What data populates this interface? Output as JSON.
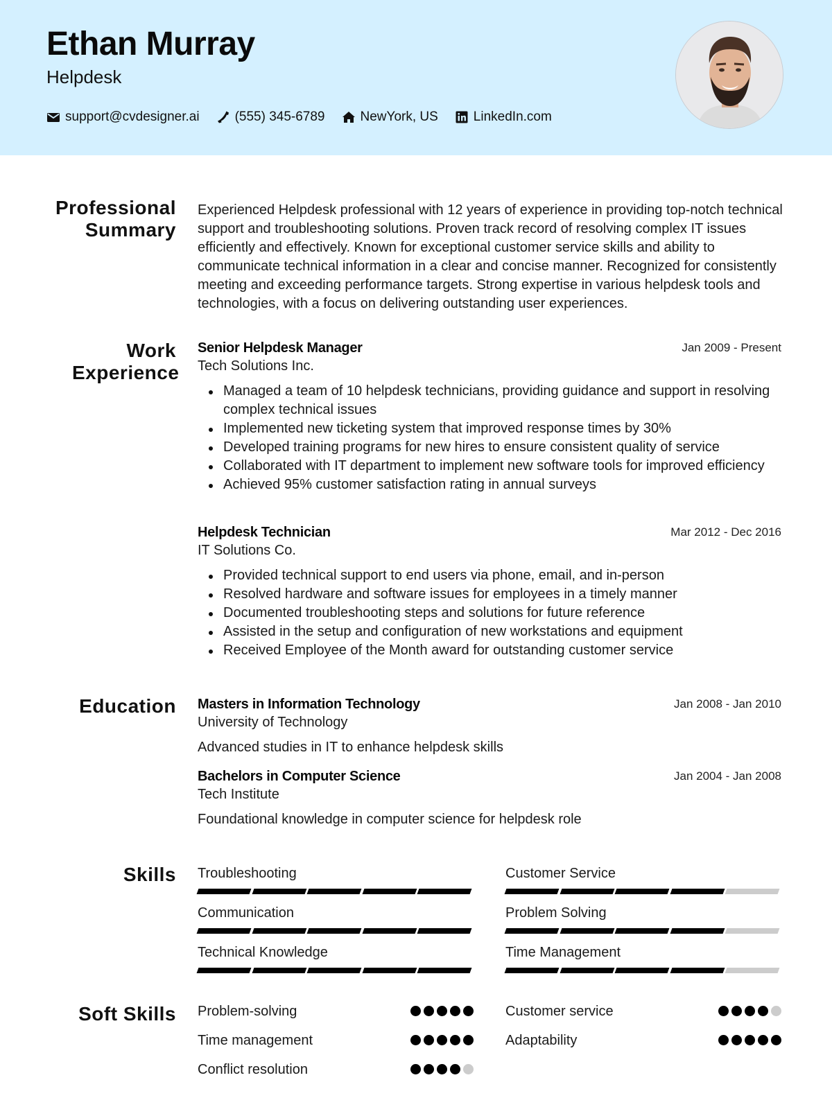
{
  "header": {
    "name": "Ethan Murray",
    "role": "Helpdesk",
    "contacts": [
      {
        "icon": "envelope-icon",
        "text": "support@cvdesigner.ai"
      },
      {
        "icon": "phone-icon",
        "text": "(555) 345-6789"
      },
      {
        "icon": "home-icon",
        "text": "NewYork, US"
      },
      {
        "icon": "linkedin-icon",
        "text": "LinkedIn.com"
      }
    ],
    "photo_alt": "Profile photo",
    "background_color": "#d4f0ff"
  },
  "sections": {
    "summary_title": "Professional Summary",
    "experience_title": "Work Experience",
    "education_title": "Education",
    "skills_title": "Skills",
    "soft_skills_title": "Soft Skills"
  },
  "summary": "Experienced Helpdesk professional with 12 years of experience in providing top-notch technical support and troubleshooting solutions. Proven track record of resolving complex IT issues efficiently and effectively. Known for exceptional customer service skills and ability to communicate technical information in a clear and concise manner. Recognized for consistently meeting and exceeding performance targets. Strong expertise in various helpdesk tools and technologies, with a focus on delivering outstanding user experiences.",
  "experience": [
    {
      "title": "Senior Helpdesk Manager",
      "date": "Jan 2009 - Present",
      "company": "Tech Solutions Inc.",
      "bullets": [
        "Managed a team of 10 helpdesk technicians, providing guidance and support in resolving complex technical issues",
        "Implemented new ticketing system that improved response times by 30%",
        "Developed training programs for new hires to ensure consistent quality of service",
        "Collaborated with IT department to implement new software tools for improved efficiency",
        "Achieved 95% customer satisfaction rating in annual surveys"
      ]
    },
    {
      "title": "Helpdesk Technician",
      "date": "Mar 2012 - Dec 2016",
      "company": "IT Solutions Co.",
      "bullets": [
        "Provided technical support to end users via phone, email, and in-person",
        "Resolved hardware and software issues for employees in a timely manner",
        "Documented troubleshooting steps and solutions for future reference",
        "Assisted in the setup and configuration of new workstations and equipment",
        "Received Employee of the Month award for outstanding customer service"
      ]
    }
  ],
  "education": [
    {
      "degree": "Masters in Information Technology",
      "date": "Jan 2008 - Jan 2010",
      "school": "University of Technology",
      "description": "Advanced studies in IT to enhance helpdesk skills"
    },
    {
      "degree": "Bachelors in Computer Science",
      "date": "Jan 2004 - Jan 2008",
      "school": "Tech Institute",
      "description": "Foundational knowledge in computer science for helpdesk role"
    }
  ],
  "skills": [
    {
      "label": "Troubleshooting",
      "level": 5,
      "max": 5
    },
    {
      "label": "Customer Service",
      "level": 4,
      "max": 5
    },
    {
      "label": "Communication",
      "level": 5,
      "max": 5
    },
    {
      "label": "Problem Solving",
      "level": 4,
      "max": 5
    },
    {
      "label": "Technical Knowledge",
      "level": 5,
      "max": 5
    },
    {
      "label": "Time Management",
      "level": 4,
      "max": 5
    }
  ],
  "soft_skills": [
    {
      "label": "Problem-solving",
      "level": 5,
      "max": 5
    },
    {
      "label": "Customer service",
      "level": 4,
      "max": 5
    },
    {
      "label": "Time management",
      "level": 5,
      "max": 5
    },
    {
      "label": "Adaptability",
      "level": 5,
      "max": 5
    },
    {
      "label": "Conflict resolution",
      "level": 4,
      "max": 5
    }
  ],
  "colors": {
    "header_bg": "#d4f0ff",
    "filled": "#000000",
    "empty": "#cccccc"
  }
}
